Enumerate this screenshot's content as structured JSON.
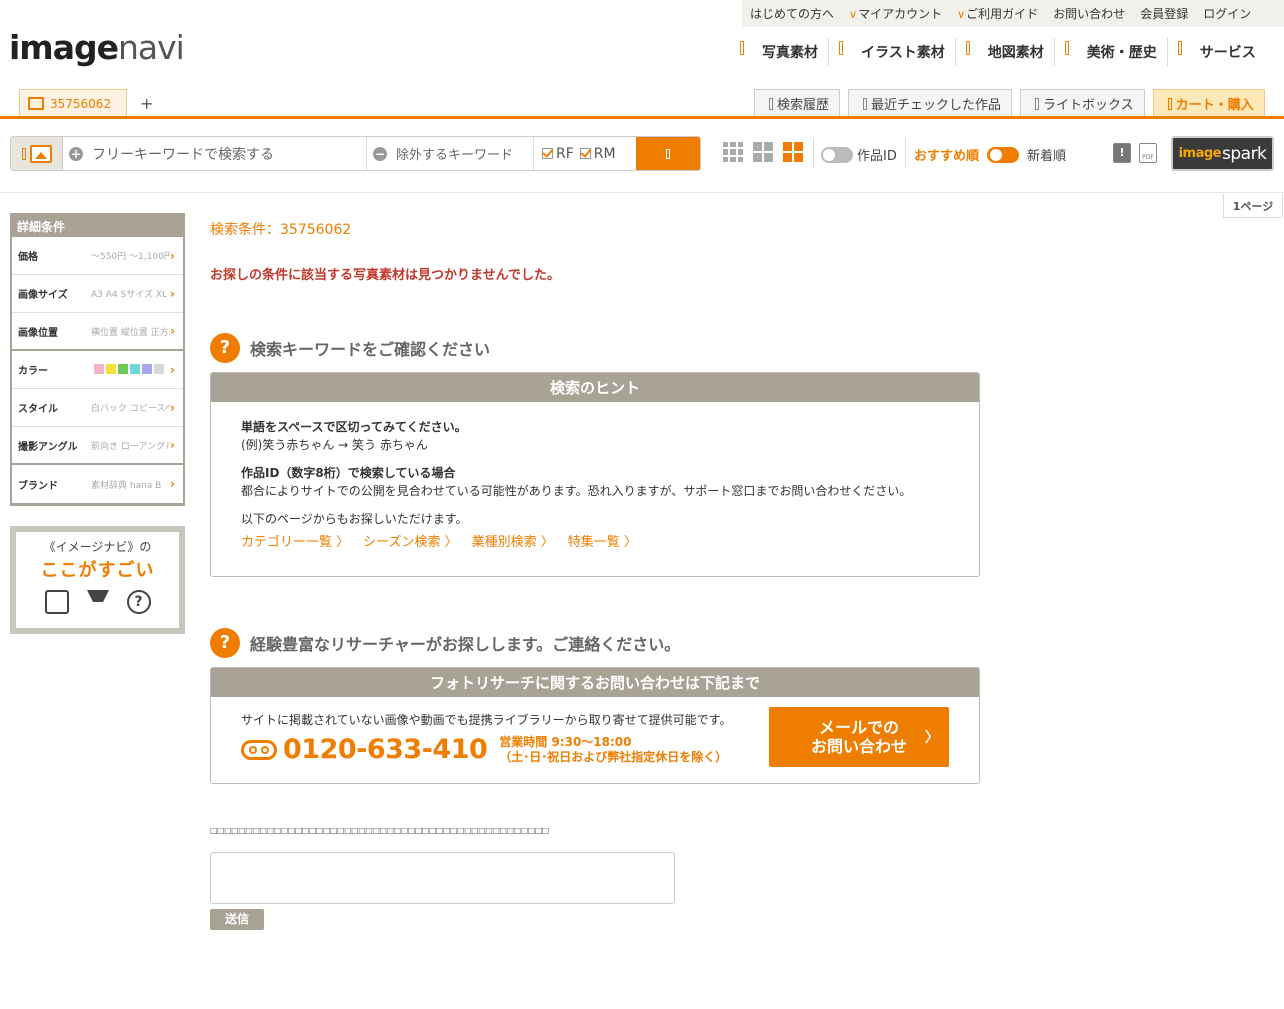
{
  "logo": {
    "bold": "image",
    "light": "navi"
  },
  "top_links": [
    {
      "label": "はじめての方へ",
      "chev": false
    },
    {
      "label": "マイアカウント",
      "chev": true
    },
    {
      "label": "ご利用ガイド",
      "chev": true
    },
    {
      "label": "お問い合わせ",
      "chev": false
    },
    {
      "label": "会員登録",
      "chev": false
    },
    {
      "label": "ログイン",
      "chev": false
    }
  ],
  "main_nav": [
    "写真素材",
    "イラスト素材",
    "地図素材",
    "美術・歴史",
    "サービス"
  ],
  "tabs": {
    "active": "35756062",
    "add": "+",
    "right": [
      "検索履歴",
      "最近チェックした作品",
      "ライトボックス",
      "カート・購入"
    ]
  },
  "search": {
    "keyword_placeholder": "フリーキーワードで検索する",
    "exclude_placeholder": "除外するキーワード",
    "rf": "RF",
    "rm": "RM"
  },
  "toolbar": {
    "work_id": "作品ID",
    "sort_recommended": "おすすめ順",
    "sort_new": "新着順",
    "pdf": "PDF",
    "spark_a": "image",
    "spark_b": "spark"
  },
  "page_indicator": "1ページ",
  "sidebar": {
    "title": "詳細条件",
    "rows": [
      {
        "label": "価格",
        "value": "〜550円 〜1,100円"
      },
      {
        "label": "画像サイズ",
        "value": "A3 A4 Sサイズ XL"
      },
      {
        "label": "画像位置",
        "value": "横位置 縦位置 正方形"
      },
      {
        "label": "カラー",
        "value": ""
      },
      {
        "label": "スタイル",
        "value": "白バック コピースペース"
      },
      {
        "label": "撮影アングル",
        "value": "前向き ローアングル"
      },
      {
        "label": "ブランド",
        "value": "素材辞典 hana B"
      }
    ],
    "colors": [
      "#f4b4c8",
      "#f3e23a",
      "#6dca57",
      "#6ed8dc",
      "#a8a8f0",
      "#d8d8d8"
    ]
  },
  "promo": {
    "line1": "《イメージナビ》の",
    "line2": "ここがすごい"
  },
  "main": {
    "condition": "検索条件：35756062",
    "not_found": "お探しの条件に該当する写真素材は見つかりませんでした。",
    "section1_title": "検索キーワードをご確認ください",
    "hint_title": "検索のヒント",
    "hint1_b": "単語をスペースで区切ってみてください。",
    "hint1": "(例)笑う赤ちゃん → 笑う 赤ちゃん",
    "hint2_b": "作品ID（数字8桁）で検索している場合",
    "hint2": "都合によりサイトでの公開を見合わせている可能性があります。恐れ入りますが、サポート窓口までお問い合わせください。",
    "hint3": "以下のページからもお探しいただけます。",
    "links": [
      "カテゴリー一覧 〉",
      "シーズン検索 〉",
      "業種別検索 〉",
      "特集一覧 〉"
    ],
    "section2_title": "経験豊富なリサーチャーがお探しします。ご連絡ください。",
    "research_title": "フォトリサーチに関するお問い合わせは下記まで",
    "research_desc": "サイトに掲載されていない画像や動画でも提携ライブラリーから取り寄せて提供可能です。",
    "phone": "0120-633-410",
    "hours1": "営業時間 9:30〜18:00",
    "hours2": "（土･日･祝日および弊社指定休日を除く）",
    "mail_btn1": "メールでの",
    "mail_btn2": "お問い合わせ",
    "mail_arrow": "〉",
    "question_mark": "?"
  },
  "feedback": {
    "label": "□□□□□□□□□□□□□□□□□□□□□□□□□□□□□□□□□□□□□□□□□□□□□□□□",
    "send": "送信"
  }
}
